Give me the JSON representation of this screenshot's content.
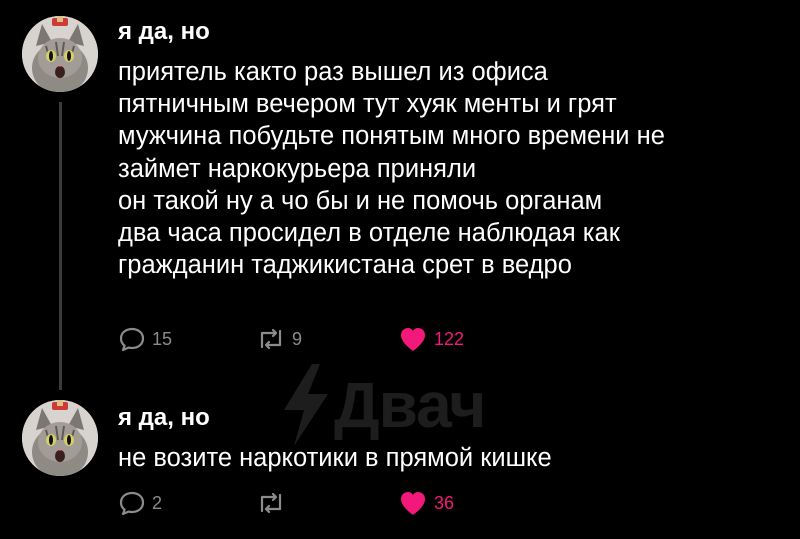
{
  "posts": [
    {
      "author": "я да, но",
      "text": "приятель както раз вышел из офиса\nпятничным вечером тут хуяк менты и грят\nмужчина побудьте понятым много времени не\nзаймет наркокурьера приняли\nон такой ну а чо бы и не помочь органам\nдва часа просидел в отделе наблюдая как\nгражданин таджикистана срет в ведро",
      "replies": "15",
      "reposts": "9",
      "likes": "122"
    },
    {
      "author": "я да, но",
      "text": "не возите наркотики в прямой кишке",
      "replies": "2",
      "reposts": "",
      "likes": "36"
    }
  ],
  "watermark": "Двач",
  "colors": {
    "background": "#000000",
    "text": "#ffffff",
    "muted": "#8b8b8b",
    "like": "#f2197a",
    "thread_line": "#3a3a3a"
  },
  "icons": [
    "avatar-cat",
    "reply-icon",
    "repost-icon",
    "heart-icon",
    "lightning-icon"
  ]
}
